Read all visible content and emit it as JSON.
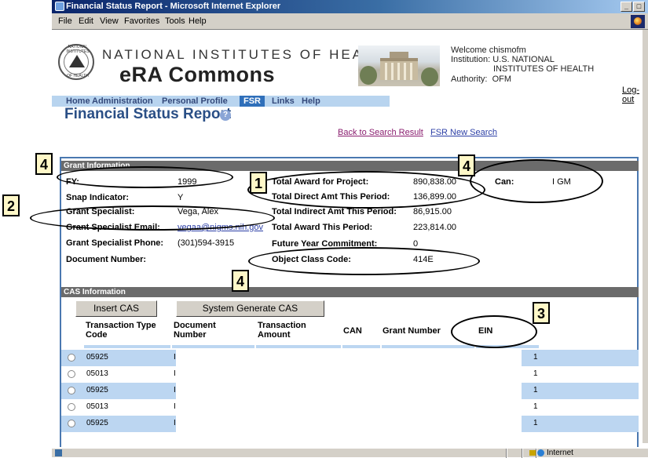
{
  "window": {
    "title": "Financial Status Report - Microsoft Internet Explorer",
    "controls": [
      "_",
      "□"
    ]
  },
  "menu": [
    "File",
    "Edit",
    "View",
    "Favorites",
    "Tools",
    "Help"
  ],
  "header": {
    "seal_top": "NATIONAL INSTITUTES",
    "seal_bottom": "OF HEALTH",
    "org_name": "NATIONAL INSTITUTES OF HEALTH",
    "app_name": "eRA Commons",
    "welcome": "Welcome  chismofm",
    "institution_label": "Institution:",
    "institution_line1": "U.S. NATIONAL",
    "institution_line2": "INSTITUTES OF HEALTH",
    "authority_label": "Authority:",
    "authority_value": "OFM",
    "logout": "Log-out"
  },
  "nav": [
    {
      "label": "Home"
    },
    {
      "label": "Administration"
    },
    {
      "label": "Personal Profile"
    },
    {
      "label": "FSR"
    },
    {
      "label": "Links"
    },
    {
      "label": "Help"
    }
  ],
  "page": {
    "title": "Financial Status Report",
    "back_link": "Back to Search Result",
    "new_search_link": "FSR New Search"
  },
  "grant_info": {
    "section_title": "Grant Information",
    "left": [
      {
        "label": "FY:",
        "value": "1999"
      },
      {
        "label": "Snap Indicator:",
        "value": "Y"
      },
      {
        "label": "Grant Specialist:",
        "value": "Vega, Alex"
      },
      {
        "label": "Grant Specialist Email:",
        "value": "vegaa@nigms.nih.gov"
      },
      {
        "label": "Grant Specialist Phone:",
        "value": "(301)594-3915"
      },
      {
        "label": "Document Number:",
        "value": ""
      }
    ],
    "middle": [
      {
        "label": "Total Award for Project:",
        "value": "890,838.00"
      },
      {
        "label": "Total Direct Amt This Period:",
        "value": "136,899.00"
      },
      {
        "label": "Total Indirect Amt This Period:",
        "value": "86,915.00"
      },
      {
        "label": "Total Award This Period:",
        "value": "223,814.00"
      },
      {
        "label": "Future Year Commitment:",
        "value": "0"
      },
      {
        "label": "Object Class Code:",
        "value": "414E"
      }
    ],
    "can_label": "Can:",
    "can_value": "I GM"
  },
  "cas": {
    "section_title": "CAS Information",
    "insert_button": "Insert CAS",
    "generate_button": "System Generate CAS",
    "columns": [
      "Transaction Type Code",
      "Document Number",
      "Transaction Amount",
      "CAN",
      "Grant Number",
      "EIN"
    ],
    "rows": [
      {
        "code": "05925",
        "doc": "I",
        "ein": "1"
      },
      {
        "code": "05013",
        "doc": "I",
        "ein": "1"
      },
      {
        "code": "05925",
        "doc": "I",
        "ein": "1"
      },
      {
        "code": "05013",
        "doc": "I",
        "ein": "1"
      },
      {
        "code": "05925",
        "doc": "I",
        "ein": "1"
      }
    ]
  },
  "callouts": [
    "4",
    "1",
    "4",
    "2",
    "4",
    "3"
  ],
  "status_bar": {
    "zone": "Internet"
  },
  "colors": {
    "title_bar": "#0a246a",
    "nav_bar": "#b8d4ef",
    "page_title": "#2a4f86",
    "section_bar": "#6b6b6b",
    "row_highlight": "#bcd6f1",
    "callout_fill": "#fff8c8"
  }
}
